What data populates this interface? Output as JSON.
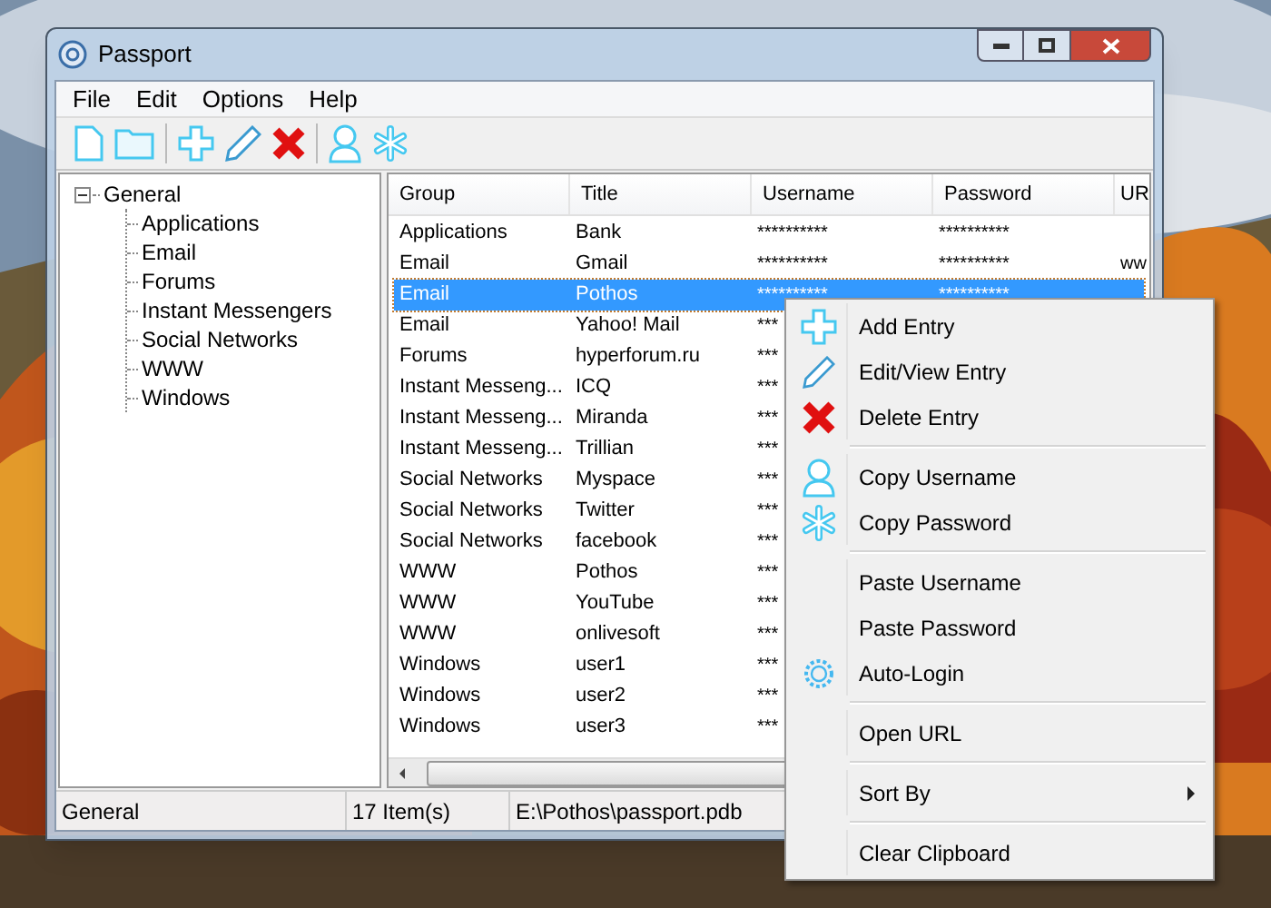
{
  "window": {
    "title": "Passport"
  },
  "menu_bar": [
    "File",
    "Edit",
    "Options",
    "Help"
  ],
  "tree": [
    {
      "label": "General",
      "expanded": true,
      "children": [
        {
          "label": "Applications"
        },
        {
          "label": "Email"
        },
        {
          "label": "Forums"
        },
        {
          "label": "Instant Messengers"
        },
        {
          "label": "Social Networks"
        },
        {
          "label": "WWW"
        },
        {
          "label": "Windows"
        }
      ]
    }
  ],
  "table": {
    "columns": [
      "Group",
      "Title",
      "Username",
      "Password",
      "UR"
    ],
    "rows": [
      {
        "selected": false,
        "cells": [
          "Applications",
          "Bank",
          "**********",
          "**********"
        ]
      },
      {
        "selected": false,
        "cells": [
          "Email",
          "Gmail",
          "**********",
          "**********",
          "ww"
        ]
      },
      {
        "selected": true,
        "cells": [
          "Email",
          "Pothos",
          "**********",
          "**********"
        ]
      },
      {
        "selected": false,
        "cells": [
          "Email",
          "Yahoo! Mail",
          "***"
        ]
      },
      {
        "selected": false,
        "cells": [
          "Forums",
          "hyperforum.ru",
          "***"
        ]
      },
      {
        "selected": false,
        "cells": [
          "Instant Messeng...",
          "ICQ",
          "***"
        ]
      },
      {
        "selected": false,
        "cells": [
          "Instant Messeng...",
          "Miranda",
          "***"
        ]
      },
      {
        "selected": false,
        "cells": [
          "Instant Messeng...",
          "Trillian",
          "***"
        ]
      },
      {
        "selected": false,
        "cells": [
          "Social Networks",
          "Myspace",
          "***"
        ]
      },
      {
        "selected": false,
        "cells": [
          "Social Networks",
          "Twitter",
          "***"
        ]
      },
      {
        "selected": false,
        "cells": [
          "Social Networks",
          "facebook",
          "***"
        ]
      },
      {
        "selected": false,
        "cells": [
          "WWW",
          "Pothos",
          "***"
        ]
      },
      {
        "selected": false,
        "cells": [
          "WWW",
          "YouTube",
          "***"
        ]
      },
      {
        "selected": false,
        "cells": [
          "WWW",
          "onlivesoft",
          "***"
        ]
      },
      {
        "selected": false,
        "cells": [
          "Windows",
          "user1",
          "***"
        ]
      },
      {
        "selected": false,
        "cells": [
          "Windows",
          "user2",
          "***"
        ]
      },
      {
        "selected": false,
        "cells": [
          "Windows",
          "user3",
          "***"
        ]
      }
    ]
  },
  "status_bar": [
    "General",
    "17 Item(s)",
    "E:\\Pothos\\passport.pdb"
  ],
  "context_menu": [
    [
      {
        "label": "Add Entry"
      },
      {
        "label": "Edit/View Entry"
      },
      {
        "label": "Delete Entry"
      }
    ],
    [
      {
        "label": "Copy Username"
      },
      {
        "label": "Copy Password"
      }
    ],
    [
      {
        "label": "Paste Username"
      },
      {
        "label": "Paste Password"
      },
      {
        "label": "Auto-Login"
      }
    ],
    [
      {
        "label": "Open URL"
      }
    ],
    [
      {
        "label": "Sort By",
        "submenu": true
      }
    ],
    [
      {
        "label": "Clear Clipboard"
      }
    ]
  ]
}
